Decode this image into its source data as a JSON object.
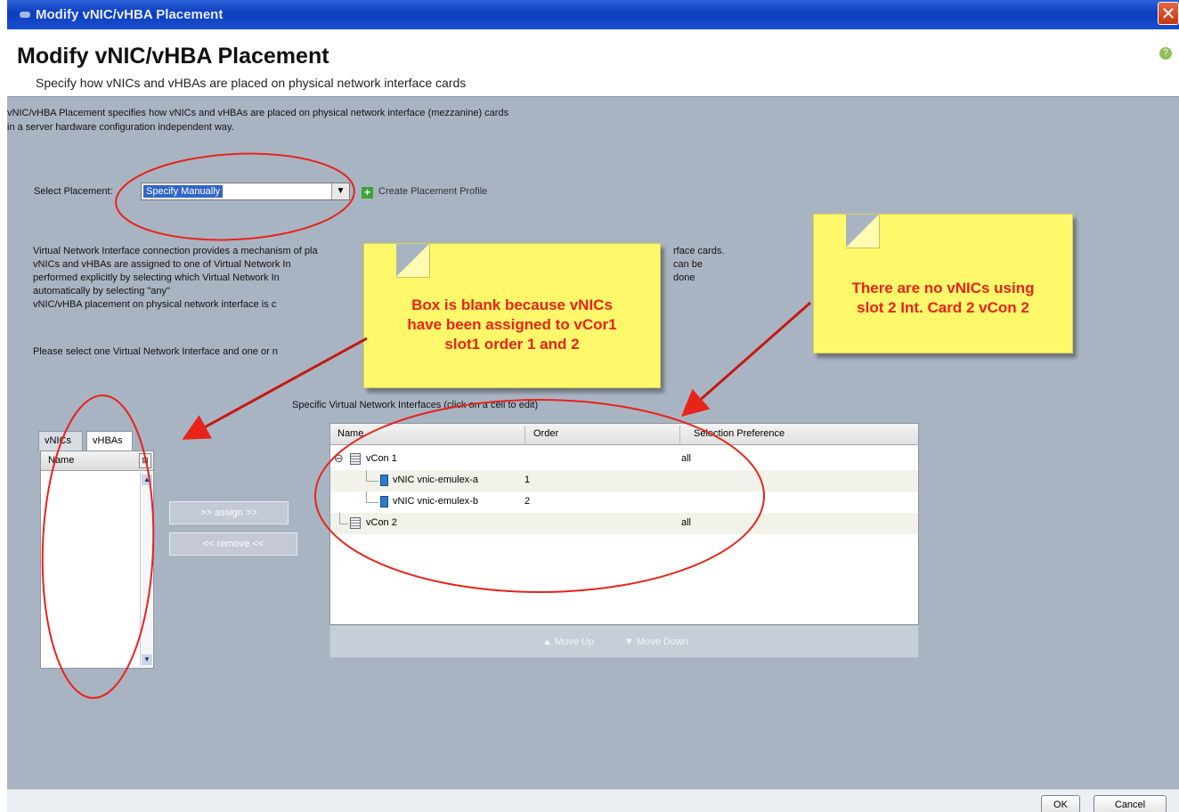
{
  "window": {
    "title": "Modify vNIC/vHBA Placement",
    "close_glyph": "✕"
  },
  "header": {
    "title": "Modify vNIC/vHBA Placement",
    "subtitle": "Specify how vNICs and vHBAs are placed on physical network interface cards",
    "help_glyph": "?"
  },
  "description": {
    "line1": "vNIC/vHBA Placement specifies how vNICs and vHBAs are placed on physical network interface (mezzanine) cards",
    "line2": "in a server hardware configuration independent way."
  },
  "placement": {
    "label": "Select Placement:",
    "selected": "Specify Manually",
    "arrow_glyph": "▼",
    "create_profile_label": "Create Placement Profile",
    "create_profile_glyph": "+"
  },
  "info": {
    "line1": "Virtual Network Interface connection provides a mechanism of pla",
    "line1_end": "rface cards.",
    "line2": "vNICs and vHBAs are assigned to one of Virtual Network In",
    "line2_end": "can be",
    "line3": "performed explicitly by selecting which Virtual Network In",
    "line3_end": "done",
    "line4": "automatically by selecting \"any\"",
    "line5": "vNIC/vHBA placement on physical network interface is c",
    "select_one": "Please select one Virtual Network Interface and one or n"
  },
  "left_panel": {
    "tabs": [
      "vNICs",
      "vHBAs"
    ],
    "column_header": "Name",
    "column_button_glyph": "⊞",
    "scroll_up_glyph": "▲",
    "scroll_down_glyph": "▼"
  },
  "actions": {
    "assign": ">> assign >>",
    "remove": "<< remove <<"
  },
  "grid": {
    "title": "Specific Virtual Network Interfaces (click on a cell to edit)",
    "columns": [
      "Name",
      "Order",
      "Selection Preference"
    ],
    "rows": [
      {
        "name": "vCon 1",
        "order": "",
        "pref": "all"
      },
      {
        "name": "vNIC vnic-emulex-a",
        "order": "1",
        "pref": ""
      },
      {
        "name": "vNIC vnic-emulex-b",
        "order": "2",
        "pref": ""
      },
      {
        "name": "vCon 2",
        "order": "",
        "pref": "all"
      }
    ],
    "expand_glyph": "⊖",
    "move_up": "Move Up",
    "move_down": "Move Down",
    "up_glyph": "▲",
    "down_glyph": "▼"
  },
  "notes": {
    "left": [
      "Box is blank because vNICs",
      "have been assigned to vCor1",
      "slot1 order 1 and 2"
    ],
    "right": [
      "There are no vNICs using",
      "slot 2 Int. Card 2 vCon 2"
    ]
  },
  "footer": {
    "ok": "OK",
    "cancel": "Cancel"
  },
  "colors": {
    "annotation_red": "#e8231a",
    "note_yellow": "#fff86b",
    "panel_bg": "#a9b4c3",
    "titlebar_blue": "#0d3dbf"
  },
  "icons": [
    "window-icon",
    "close-icon",
    "help-icon",
    "dropdown-arrow-icon",
    "add-icon",
    "column-chooser-icon",
    "vcon-icon",
    "vnic-icon",
    "move-up-icon",
    "move-down-icon"
  ]
}
